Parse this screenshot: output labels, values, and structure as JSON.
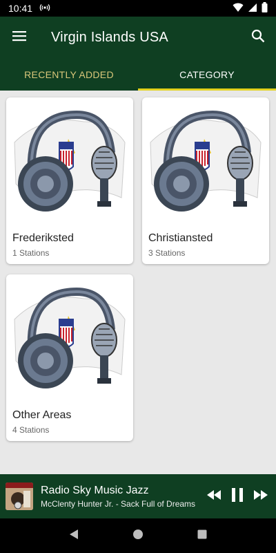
{
  "status_bar": {
    "time": "10:41"
  },
  "app_bar": {
    "title": "Virgin Islands USA"
  },
  "tabs": [
    {
      "label": "RECENTLY ADDED",
      "active": false
    },
    {
      "label": "CATEGORY",
      "active": true
    }
  ],
  "categories": [
    {
      "name": "Frederiksted",
      "count": "1 Stations"
    },
    {
      "name": "Christiansted",
      "count": "3 Stations"
    },
    {
      "name": "Other Areas",
      "count": "4 Stations"
    }
  ],
  "player": {
    "station": "Radio Sky Music Jazz",
    "track": "McClenty Hunter Jr. - Sack Full of Dreams"
  },
  "colors": {
    "primary": "#0f3f22",
    "tab_indicator": "#e3d21d",
    "inactive_tab": "#d9c77a"
  },
  "icons": [
    "menu-icon",
    "search-icon",
    "radio-signal-icon",
    "wifi-icon",
    "cell-signal-icon",
    "battery-icon",
    "rewind-icon",
    "pause-icon",
    "fast-forward-icon",
    "back-icon",
    "home-icon",
    "recents-icon"
  ]
}
